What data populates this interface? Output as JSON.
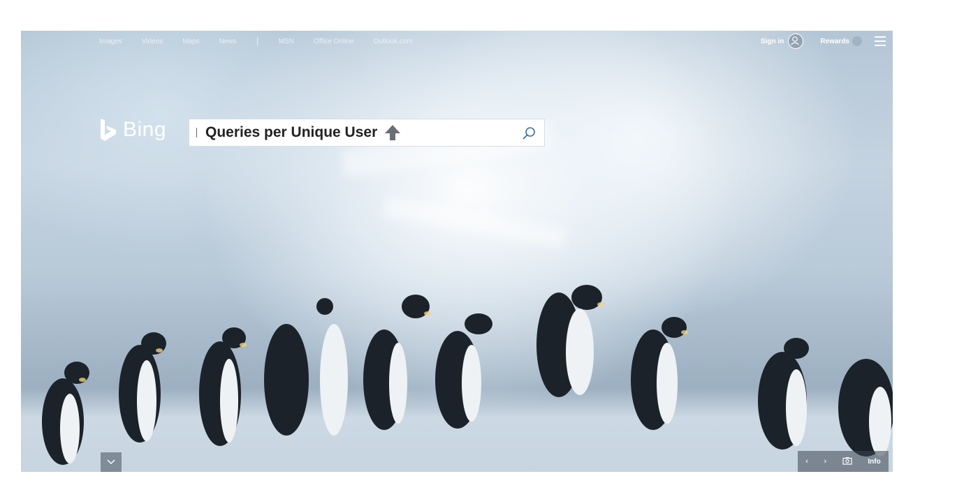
{
  "nav": {
    "links": [
      "Images",
      "Videos",
      "Maps",
      "News",
      "MSN",
      "Office Online",
      "Outlook.com"
    ],
    "separator": "|"
  },
  "header": {
    "sign_in": "Sign in",
    "rewards": "Rewards"
  },
  "logo": {
    "text": "Bing"
  },
  "search": {
    "query": "Queries per Unique User"
  },
  "image_controls": {
    "prev": "‹",
    "next": "›",
    "info": "Info"
  },
  "icons": [
    "bing-logo-icon",
    "up-arrow-icon",
    "search-icon",
    "user-avatar-icon",
    "rewards-icon",
    "hamburger-menu-icon",
    "chevron-down-icon",
    "chevron-left-icon",
    "chevron-right-icon",
    "camera-icon"
  ],
  "colors": {
    "accent_white": "#ffffff",
    "arrow_gray": "#6b6f73",
    "overlay": "#3c4652"
  }
}
